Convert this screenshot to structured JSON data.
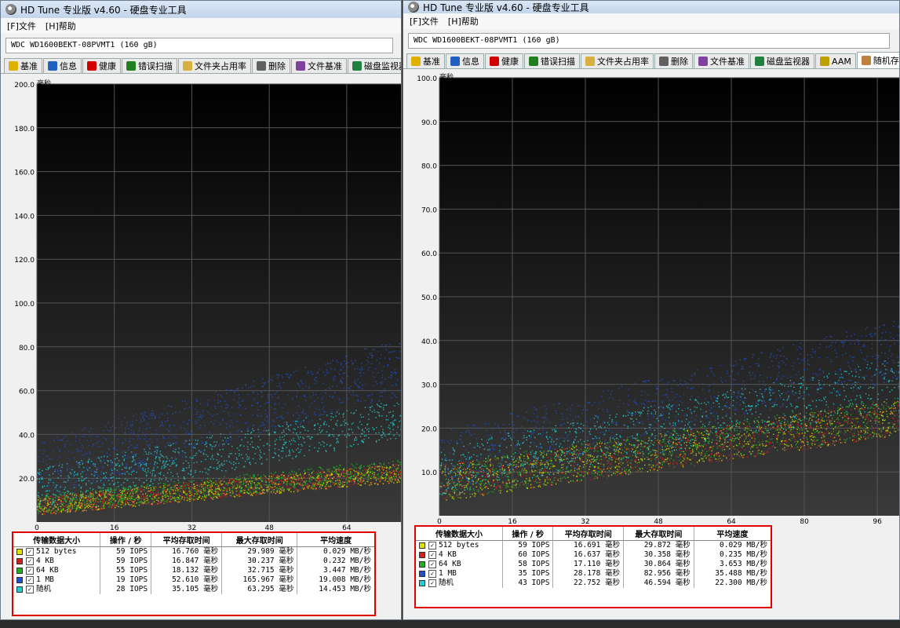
{
  "windows": [
    {
      "title": "HD Tune 专业版 v4.60 - 硬盘专业工具",
      "menu": [
        "[F]文件",
        "[H]帮助"
      ],
      "drive": "WDC WD1600BEKT-08PVMT1   (160 gB)",
      "tabs": [
        {
          "label": "基准",
          "icon": "benchmark-icon"
        },
        {
          "label": "信息",
          "icon": "info-icon"
        },
        {
          "label": "健康",
          "icon": "health-cross-icon"
        },
        {
          "label": "错误扫描",
          "icon": "magnifier-icon"
        },
        {
          "label": "文件夹占用率",
          "icon": "folder-icon"
        },
        {
          "label": "删除",
          "icon": "trash-icon"
        },
        {
          "label": "文件基准",
          "icon": "file-benchmark-icon"
        },
        {
          "label": "磁盘监视器",
          "icon": "monitor-chart-icon"
        }
      ],
      "chart": {
        "unit_label": "毫秒",
        "y_ticks": [
          "200.0",
          "180.0",
          "160.0",
          "140.0",
          "120.0",
          "100.0",
          "80.0",
          "60.0",
          "40.0",
          "20.0"
        ],
        "x_ticks": [
          "0",
          "16",
          "32",
          "48",
          "64"
        ]
      },
      "table": {
        "headers": [
          "传输数据大小",
          "操作 / 秒",
          "平均存取时间",
          "最大存取时间",
          "平均速度"
        ],
        "rows": [
          {
            "size": "512 bytes",
            "ops": "59 IOPS",
            "avg": "16.760 毫秒",
            "max": "29.989 毫秒",
            "speed": "0.029 MB/秒",
            "color": "#e0e000"
          },
          {
            "size": "4 KB",
            "ops": "59 IOPS",
            "avg": "16.847 毫秒",
            "max": "30.237 毫秒",
            "speed": "0.232 MB/秒",
            "color": "#d02020"
          },
          {
            "size": "64 KB",
            "ops": "55 IOPS",
            "avg": "18.132 毫秒",
            "max": "32.715 毫秒",
            "speed": "3.447 MB/秒",
            "color": "#20b020"
          },
          {
            "size": "1 MB",
            "ops": "19 IOPS",
            "avg": "52.610 毫秒",
            "max": "165.967 毫秒",
            "speed": "19.008 MB/秒",
            "color": "#2050d0"
          },
          {
            "size": "随机",
            "ops": "28 IOPS",
            "avg": "35.105 毫秒",
            "max": "63.295 毫秒",
            "speed": "14.453 MB/秒",
            "color": "#20d0d0"
          }
        ]
      }
    },
    {
      "title": "HD Tune 专业版 v4.60 - 硬盘专业工具",
      "menu": [
        "[F]文件",
        "[H]帮助"
      ],
      "drive": "WDC WD1600BEKT-08PVMT1   (160 gB)",
      "tabs": [
        {
          "label": "基准",
          "icon": "benchmark-icon"
        },
        {
          "label": "信息",
          "icon": "info-icon"
        },
        {
          "label": "健康",
          "icon": "health-cross-icon"
        },
        {
          "label": "错误扫描",
          "icon": "magnifier-icon"
        },
        {
          "label": "文件夹占用率",
          "icon": "folder-icon"
        },
        {
          "label": "删除",
          "icon": "trash-icon"
        },
        {
          "label": "文件基准",
          "icon": "file-benchmark-icon"
        },
        {
          "label": "磁盘监视器",
          "icon": "monitor-chart-icon"
        },
        {
          "label": "AAM",
          "icon": "speaker-icon"
        },
        {
          "label": "随机存取",
          "icon": "random-access-icon"
        }
      ],
      "active_tab": "随机存取",
      "chart": {
        "unit_label": "毫秒",
        "y_ticks": [
          "100.0",
          "90.0",
          "80.0",
          "70.0",
          "60.0",
          "50.0",
          "40.0",
          "30.0",
          "20.0",
          "10.0"
        ],
        "x_ticks": [
          "0",
          "16",
          "32",
          "48",
          "64",
          "80",
          "96"
        ]
      },
      "table": {
        "headers": [
          "传输数据大小",
          "操作 / 秒",
          "平均存取时间",
          "最大存取时间",
          "平均速度"
        ],
        "rows": [
          {
            "size": "512 bytes",
            "ops": "59 IOPS",
            "avg": "16.691 毫秒",
            "max": "29.872 毫秒",
            "speed": "0.029 MB/秒",
            "color": "#e0e000"
          },
          {
            "size": "4 KB",
            "ops": "60 IOPS",
            "avg": "16.637 毫秒",
            "max": "30.358 毫秒",
            "speed": "0.235 MB/秒",
            "color": "#d02020"
          },
          {
            "size": "64 KB",
            "ops": "58 IOPS",
            "avg": "17.110 毫秒",
            "max": "30.864 毫秒",
            "speed": "3.653 MB/秒",
            "color": "#20b020"
          },
          {
            "size": "1 MB",
            "ops": "35 IOPS",
            "avg": "28.178 毫秒",
            "max": "82.956 毫秒",
            "speed": "35.488 MB/秒",
            "color": "#2050d0"
          },
          {
            "size": "随机",
            "ops": "43 IOPS",
            "avg": "22.752 毫秒",
            "max": "46.594 毫秒",
            "speed": "22.300 MB/秒",
            "color": "#20d0d0"
          }
        ]
      }
    }
  ]
}
